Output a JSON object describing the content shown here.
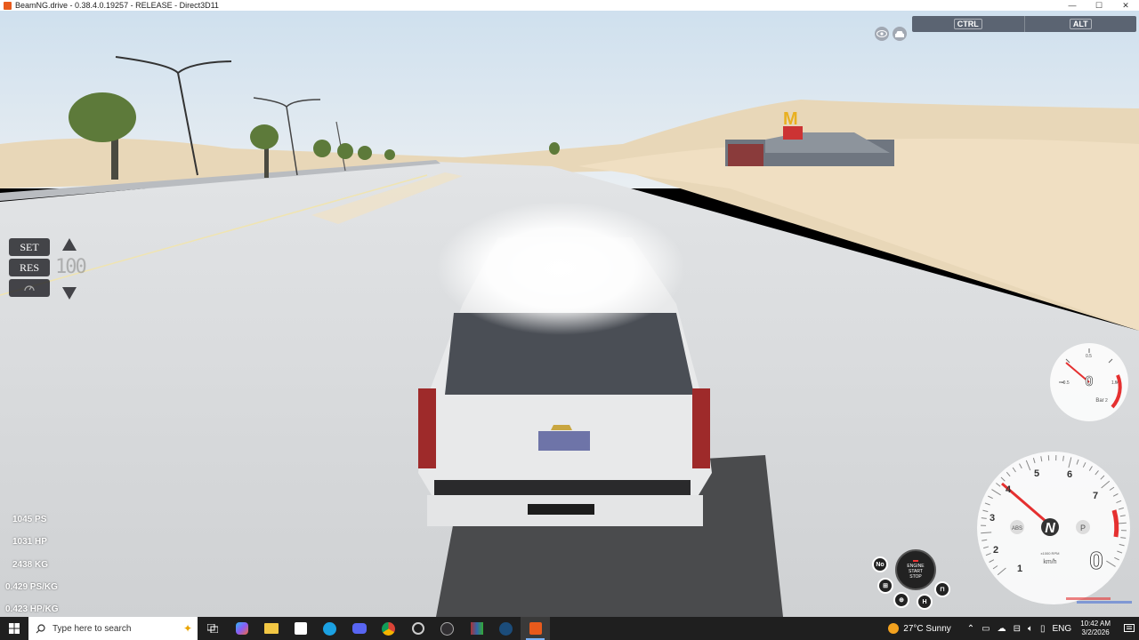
{
  "window": {
    "title": "BeamNG.drive - 0.38.4.0.19257 - RELEASE - Direct3D11",
    "minimize": "—",
    "maximize": "☐",
    "close": "✕"
  },
  "hud": {
    "modifier_keys": [
      "CTRL",
      "ALT"
    ],
    "cruise": {
      "set_label": "SET",
      "res_label": "RES",
      "target_speed": "100"
    },
    "stats": [
      "1045 PS",
      "1031 HP",
      "2438 KG",
      "0.429 PS/KG",
      "0.423 HP/KG"
    ],
    "boost_gauge": {
      "value": "0",
      "unit": "Bar",
      "ticks": [
        "-1",
        "-0.5",
        "0.5",
        "1",
        "1.5",
        "2"
      ]
    },
    "tachometer": {
      "gear": "N",
      "speed": "0",
      "speed_unit": "km/h",
      "rpm_unit": "x1000 RPM",
      "ticks": [
        "1",
        "2",
        "3",
        "4",
        "5",
        "6",
        "7"
      ],
      "abs_label": "ABS",
      "park_label": "P"
    },
    "engine_button": [
      "ENGINE",
      "START",
      "STOP"
    ],
    "no_label": "No",
    "h_label": "H"
  },
  "taskbar": {
    "search_placeholder": "Type here to search",
    "weather": "27°C  Sunny",
    "lang": "ENG",
    "time": "10:42 AM",
    "date": "3/2/2026"
  }
}
